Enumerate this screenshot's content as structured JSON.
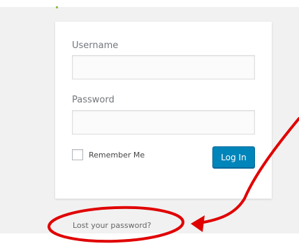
{
  "login_form": {
    "username_label": "Username",
    "username_value": "",
    "password_label": "Password",
    "password_value": "",
    "remember_label": "Remember Me",
    "remember_checked": false,
    "submit_label": "Log In"
  },
  "links": {
    "lost_password": "Lost your password?"
  },
  "colors": {
    "button": "#0085ba",
    "annotation": "#e00000",
    "page_background": "#f1f1f1"
  }
}
